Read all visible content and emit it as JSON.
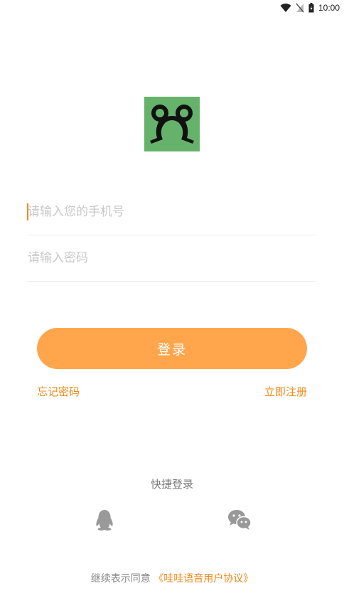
{
  "status_bar": {
    "time": "10:00",
    "icons": [
      "wifi-icon",
      "no-signal-icon",
      "battery-icon"
    ]
  },
  "logo": {
    "icon": "frog-logo-icon",
    "bg_color": "#65b36b"
  },
  "form": {
    "phone_placeholder": "请输入您的手机号",
    "phone_value": "",
    "password_placeholder": "请输入密码",
    "password_value": ""
  },
  "login_button": {
    "label": "登录",
    "color": "#ffa64d"
  },
  "links": {
    "forgot_password": "忘记密码",
    "register_now": "立即注册",
    "accent_color": "#f08a1c"
  },
  "quick_login": {
    "title": "快捷登录",
    "options": [
      "qq-icon",
      "wechat-icon"
    ]
  },
  "agreement": {
    "prefix": "继续表示同意",
    "link_text": "《哇哇语音用户协议》"
  }
}
